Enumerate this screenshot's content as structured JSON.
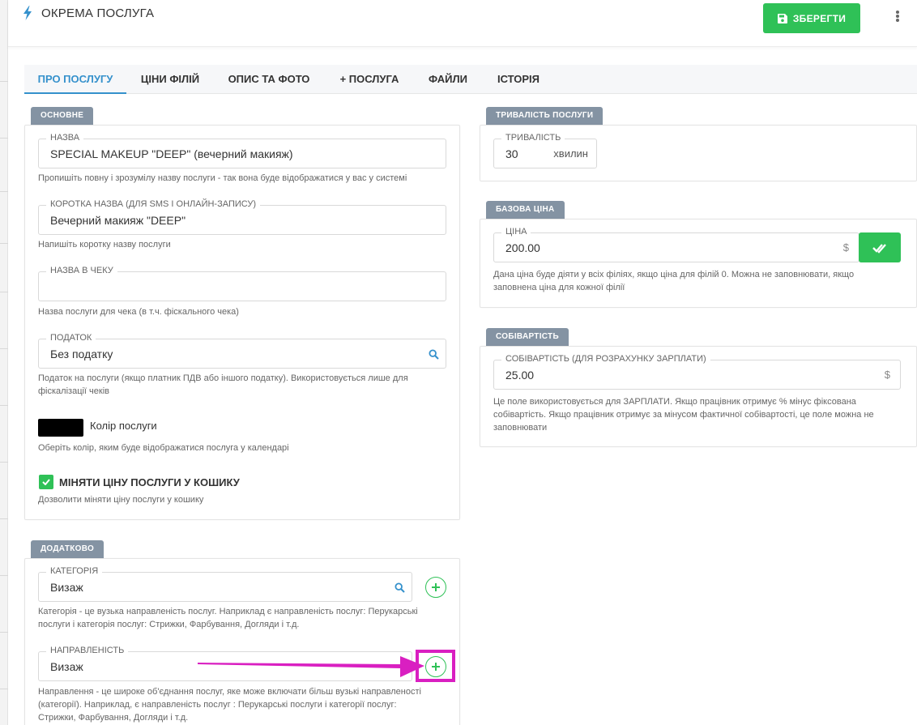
{
  "header": {
    "title": "ОКРЕМА ПОСЛУГА",
    "save_label": "ЗБЕРЕГТИ"
  },
  "tabs": [
    {
      "label": "ПРО ПОСЛУГУ",
      "active": true
    },
    {
      "label": "ЦІНИ ФІЛІЙ"
    },
    {
      "label": "ОПИС ТА ФОТО"
    },
    {
      "label": "+ ПОСЛУГА"
    },
    {
      "label": "ФАЙЛИ"
    },
    {
      "label": "ІСТОРІЯ"
    }
  ],
  "basic": {
    "tag": "ОСНОВНЕ",
    "name": {
      "label": "НАЗВА",
      "value": "SPECIAL MAKEUP \"DEEP\" (вечерний макияж)",
      "hint": "Пропишіть повну і зрозумілу назву послуги - так вона буде відображатися у вас у системі"
    },
    "short_name": {
      "label": "КОРОТКА НАЗВА (ДЛЯ SMS І ОНЛАЙН-ЗАПИСУ)",
      "value": "Вечерний макияж \"DEEP\"",
      "hint": "Напишіть коротку назву послуги"
    },
    "receipt_name": {
      "label": "НАЗВА В ЧЕКУ",
      "value": "",
      "hint": "Назва послуги для чека (в т.ч. фіскального чека)"
    },
    "tax": {
      "label": "ПОДАТОК",
      "value": "Без податку",
      "hint_line1": "Податок на послуги (якщо платник ПДВ або іншого податку). Використовується лише для",
      "hint_line2": "фіскалізації чеків"
    },
    "color": {
      "label": "Колір послуги",
      "value": "#000000",
      "hint": "Оберіть колір, яким буде відображатися послуга у календарі"
    },
    "change_price": {
      "label": "МІНЯТИ ЦІНУ ПОСЛУГИ У КОШИКУ",
      "checked": true,
      "hint": "Дозволити міняти ціну послуги у кошику"
    }
  },
  "extra": {
    "tag": "ДОДАТКОВО",
    "category": {
      "label": "КАТЕГОРІЯ",
      "value": "Визаж",
      "hint_line1": "Категорія - це вузька направленість послуг. Наприклад є направленість послуг: Перукарські",
      "hint_line2": "послуги і категорія послуг: Стрижки, Фарбування, Догляди і т.д."
    },
    "direction": {
      "label": "НАПРАВЛЕНІСТЬ",
      "value": "Визаж",
      "hint_line1": "Направлення - це широке об'єднання послуг, яке може включати більш вузькі направленості",
      "hint_line2": "(категорії). Наприклад, є направленість послуг : Перукарські послуги і категорії послуг:",
      "hint_line3": "Стрижки, Фарбування, Догляди і т.д."
    }
  },
  "duration": {
    "tag": "ТРИВАЛІСТЬ ПОСЛУГИ",
    "label": "ТРИВАЛІСТЬ",
    "value": "30",
    "unit": "хвилин"
  },
  "base_price": {
    "tag": "БАЗОВА ЦІНА",
    "label": "ЦІНА",
    "value": "200.00",
    "currency": "$",
    "hint_line1": "Дана ціна буде діяти у всіх філіях, якщо ціна для філій 0. Можна не заповнювати, якщо",
    "hint_line2": "заповнена ціна для кожної філії"
  },
  "cost": {
    "tag": "СОБІВАРТІСТЬ",
    "label": "СОБІВАРТІСТЬ (ДЛЯ РОЗРАХУНКУ ЗАРПЛАТИ)",
    "value": "25.00",
    "currency": "$",
    "hint_line1": "Це поле використовується для ЗАРПЛАТИ. Якщо працівник отримує % мінус фіксована",
    "hint_line2": "собівартість. Якщо працівник отримує за мінусом фактичної собівартості, це поле можна не",
    "hint_line3": "заповнювати"
  },
  "colors": {
    "accent": "#3591cc",
    "green": "#2fc157",
    "tag_bg": "#8493a3",
    "annotation": "#d91fc1"
  },
  "icons": {
    "title": "bolt-icon",
    "save": "floppy-disk-icon",
    "more": "vertical-dots-icon",
    "search": "search-icon",
    "add": "plus-circle-icon",
    "apply": "double-check-icon",
    "checkbox": "check-icon"
  }
}
